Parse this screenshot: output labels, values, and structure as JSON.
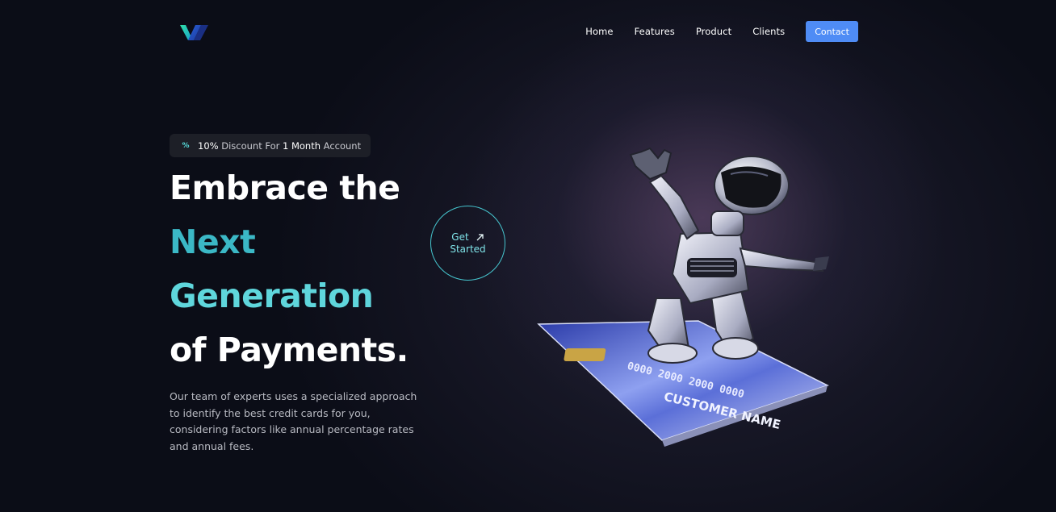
{
  "nav": {
    "links": [
      "Home",
      "Features",
      "Product",
      "Clients"
    ],
    "contact_label": "Contact"
  },
  "badge": {
    "icon": "percent-icon",
    "part1": "10%",
    "part2": " Discount For ",
    "part3": "1 Month",
    "part4": " Account"
  },
  "hero": {
    "line1": "Embrace the",
    "line2": "Next",
    "line3": "Generation",
    "line4": "of Payments."
  },
  "description": "Our team of experts uses a specialized approach to identify the best credit cards for you, considering factors like annual percentage rates and annual fees.",
  "cta": {
    "line1": "Get",
    "line2": "Started",
    "icon": "arrow-up-right-icon"
  },
  "card": {
    "number": "0000 2000 2000 0000",
    "name": "CUSTOMER NAME"
  },
  "colors": {
    "accent": "#4f8cf5",
    "teal": "#3bb8c6",
    "background": "#0b0d17"
  }
}
